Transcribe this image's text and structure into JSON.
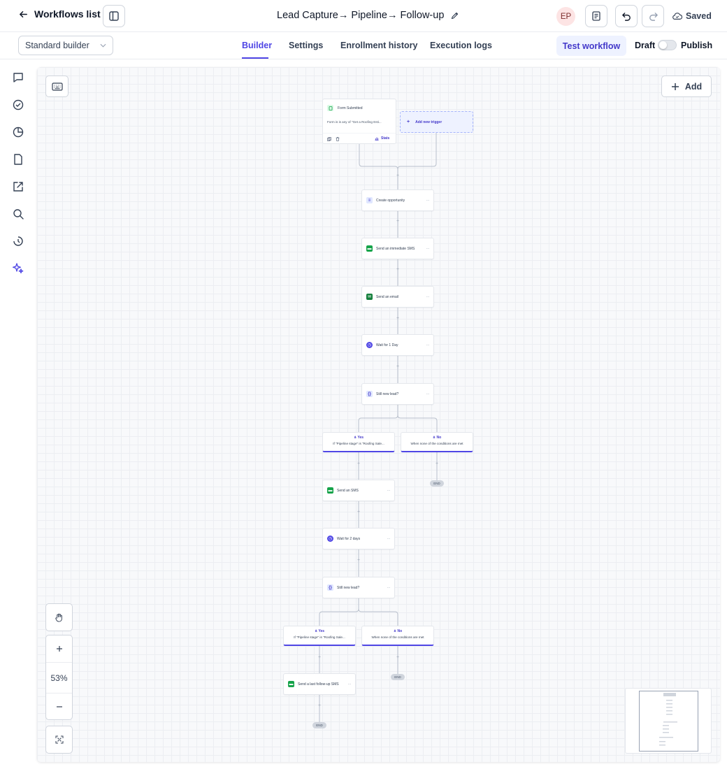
{
  "header": {
    "back_label": "Workflows list",
    "workflow_title": "Lead Capture→ Pipeline→ Follow-up",
    "avatar_initials": "EP",
    "status": "Saved"
  },
  "subbar": {
    "builder_select": "Standard builder",
    "tabs": [
      "Builder",
      "Settings",
      "Enrollment history",
      "Execution logs"
    ],
    "active_tab": "Builder",
    "test_label": "Test workflow",
    "draft_label": "Draft",
    "publish_label": "Publish",
    "publish_toggle_on": false
  },
  "rail": {
    "icons": [
      "chat-icon",
      "check-circle-icon",
      "pie-chart-icon",
      "document-icon",
      "external-link-icon",
      "search-icon",
      "history-icon",
      "sparkle-icon"
    ]
  },
  "canvas": {
    "add_label": "Add",
    "zoom": "53%",
    "trigger": {
      "title": "Form Submitted",
      "condition": "Form is is any of \"Get a Roofing Esti...",
      "stats_label": "Stats"
    },
    "add_trigger_label": "Add new trigger",
    "actions": {
      "create_opportunity": "Create opportunity",
      "immediate_sms": "Send an immediate SMS",
      "email": "Send an email",
      "wait_1": "Wait for 1 Day",
      "cond_1": "Still new lead?",
      "sms": "Send an SMS",
      "wait_2": "Wait for 2 days",
      "cond_2": "Still new lead?",
      "last_sms": "Send a last follow-up SMS"
    },
    "branches": {
      "yes_label": "Yes",
      "no_label": "No",
      "yes_desc": "If \"Pipeline stage\" is \"Roofing Sale...",
      "no_desc": "When none of the conditions are met"
    },
    "end_label": "END",
    "plus_symbol": "+",
    "node_menu": "···"
  },
  "colors": {
    "accent": "#4f46e5",
    "sms_green": "#16a34a",
    "canvas_bg": "#f8f9fb"
  }
}
